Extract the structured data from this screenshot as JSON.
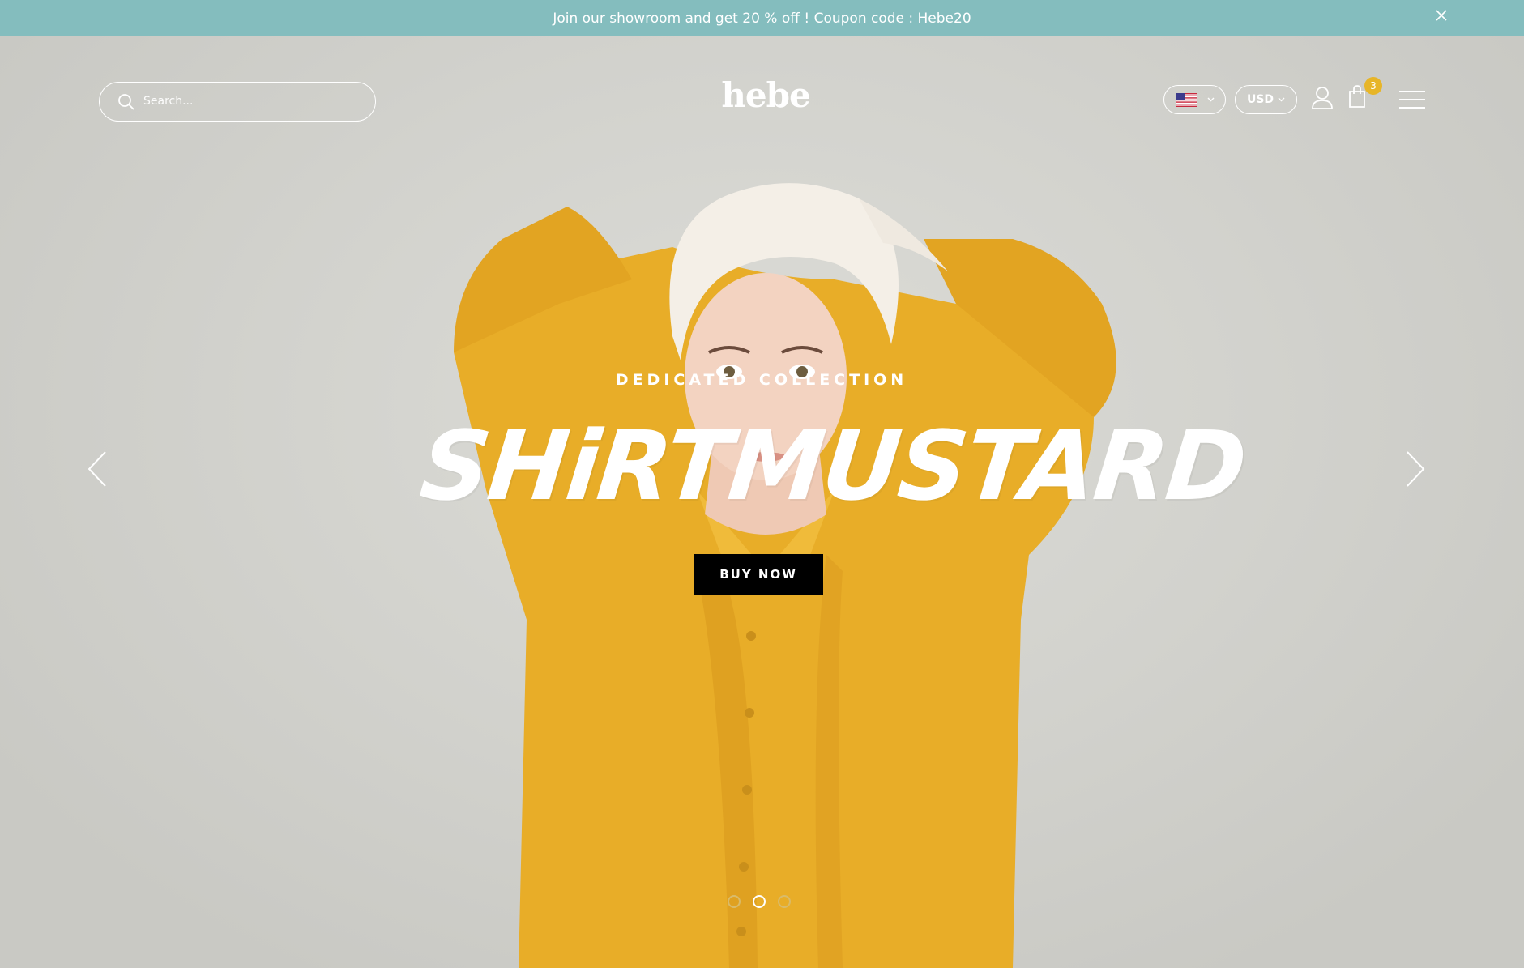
{
  "announcement": {
    "text": "Join our showroom and get 20 % off ! Coupon code : Hebe20"
  },
  "header": {
    "search_placeholder": "Search...",
    "logo": "hebe",
    "currency": "USD",
    "cart_count": "3"
  },
  "slide": {
    "subtitle": "DEDICATED COLLECTION",
    "title": "SHiRTMUSTARD",
    "button": "BUY NOW"
  },
  "slider": {
    "dot_count": 3,
    "active_index": 1
  },
  "colors": {
    "announcement_bg": "#84bdbe",
    "cart_badge": "#e7b528",
    "shirt": "#e8ad28",
    "button_bg": "#000000"
  },
  "icons": [
    "close-icon",
    "search-icon",
    "us-flag-icon",
    "chevron-down-icon",
    "user-icon",
    "cart-icon",
    "menu-icon",
    "arrow-left-icon",
    "arrow-right-icon"
  ]
}
